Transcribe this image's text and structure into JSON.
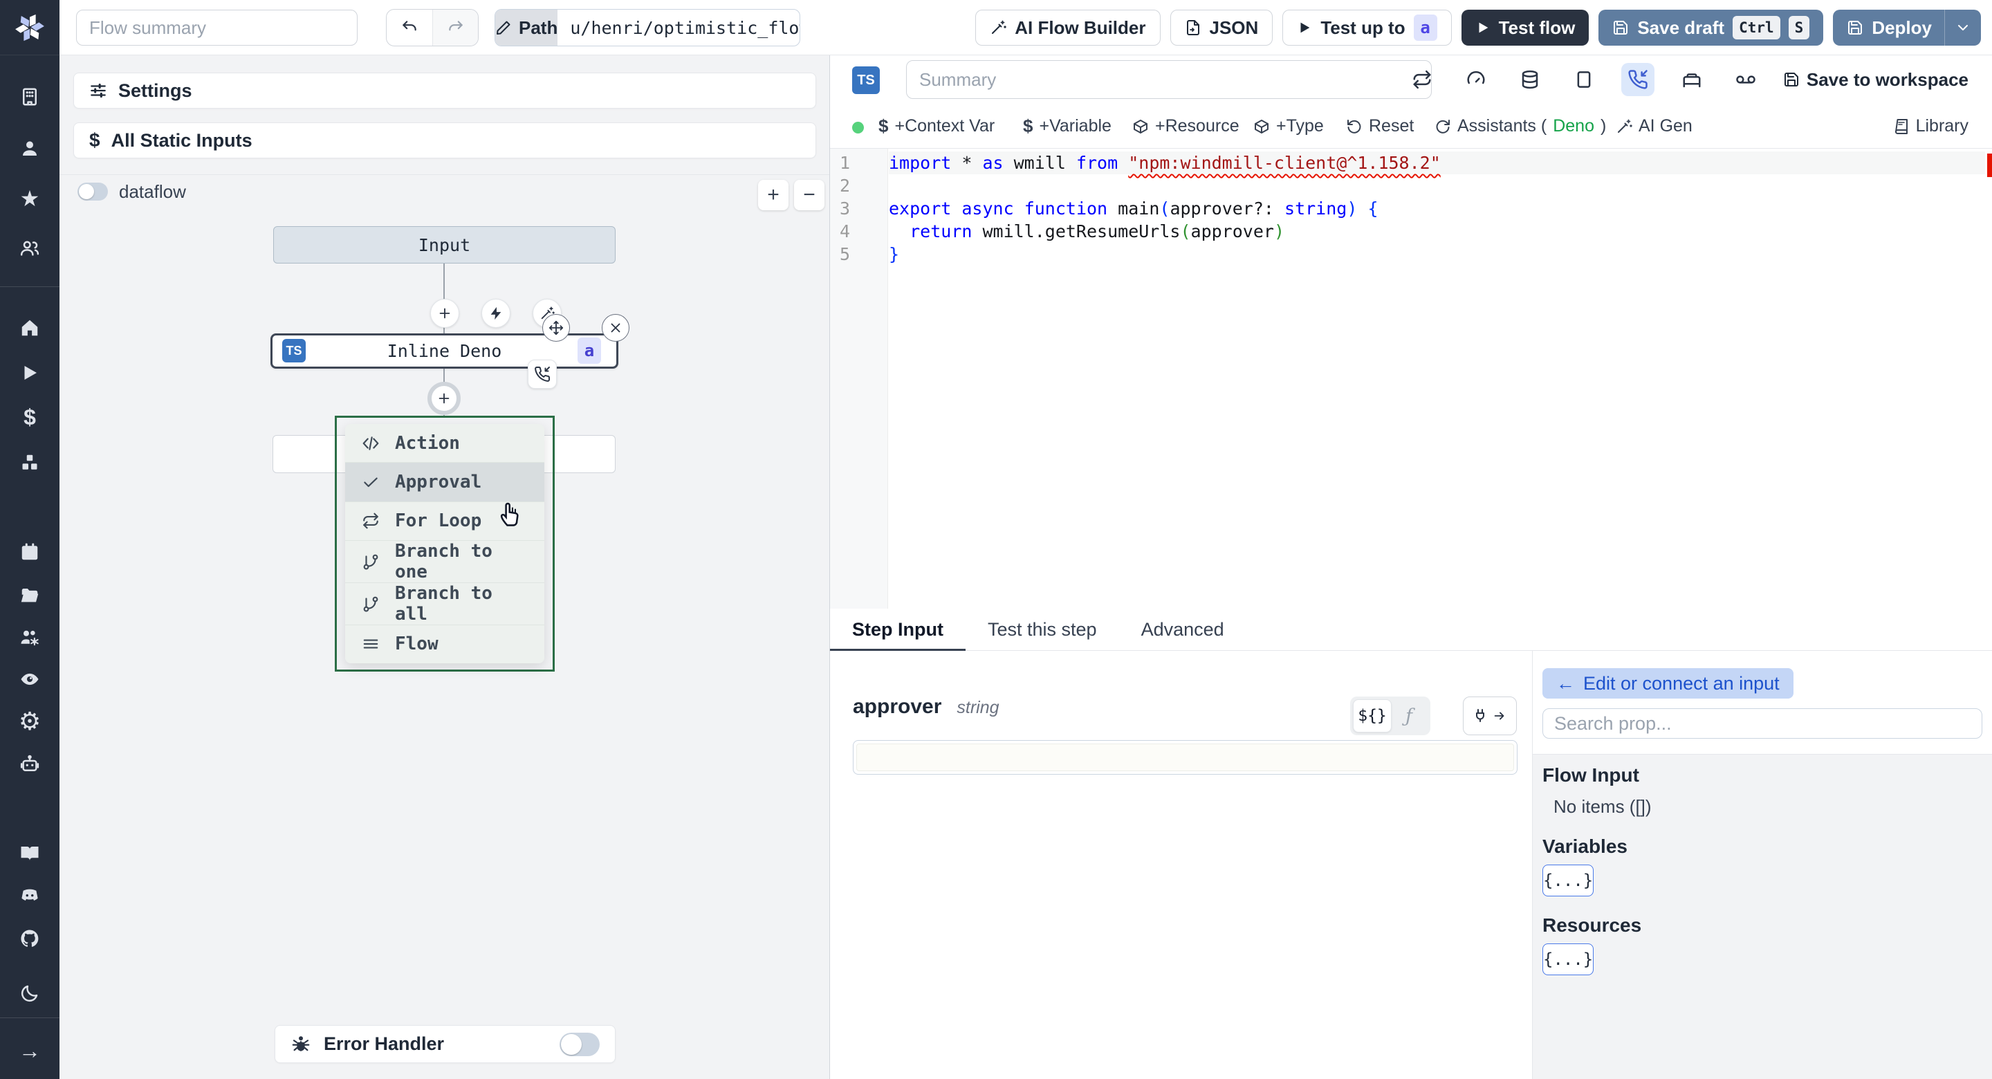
{
  "topbar": {
    "flow_summary_placeholder": "Flow summary",
    "path_label": "Path",
    "path_value": "u/henri/optimistic_flow",
    "ai_flow_builder": "AI Flow Builder",
    "json_label": "JSON",
    "test_up_to": "Test up to",
    "test_up_to_badge": "a",
    "test_flow": "Test flow",
    "save_draft": "Save draft",
    "kbd_ctrl": "Ctrl",
    "kbd_s": "S",
    "deploy": "Deploy"
  },
  "flow_panel": {
    "settings": "Settings",
    "all_static_inputs": "All Static Inputs",
    "dataflow": "dataflow",
    "input_node": "Input",
    "step_node": {
      "ts": "TS",
      "label": "Inline Deno",
      "badge": "a"
    },
    "menu": {
      "items": [
        {
          "label": "Action"
        },
        {
          "label": "Approval"
        },
        {
          "label": "For Loop"
        },
        {
          "label": "Branch to one"
        },
        {
          "label": "Branch to all"
        },
        {
          "label": "Flow"
        }
      ]
    },
    "error_handler": "Error Handler"
  },
  "editor": {
    "ts": "TS",
    "summary_placeholder": "Summary",
    "save_to_workspace": "Save to workspace",
    "toolbar": {
      "context_var": "+Context Var",
      "variable": "+Variable",
      "resource": "+Resource",
      "type": "+Type",
      "reset": "Reset",
      "assistants_prefix": "Assistants (",
      "assistants_lang": "Deno",
      "assistants_suffix": ")",
      "ai_gen": "AI Gen",
      "library": "Library"
    },
    "code": {
      "lines": [
        [
          [
            "kw",
            "import"
          ],
          [
            "pl",
            " * "
          ],
          [
            "kw",
            "as"
          ],
          [
            "pl",
            " wmill "
          ],
          [
            "kw",
            "from"
          ],
          [
            "pl",
            " "
          ],
          [
            "se",
            "\"npm:windmill-client@^1.158.2\""
          ]
        ],
        [],
        [
          [
            "kw",
            "export"
          ],
          [
            "pl",
            " "
          ],
          [
            "kw",
            "async"
          ],
          [
            "pl",
            " "
          ],
          [
            "kw",
            "function"
          ],
          [
            "pl",
            " main"
          ],
          [
            "b1",
            "("
          ],
          [
            "pl",
            "approver?: "
          ],
          [
            "kw",
            "string"
          ],
          [
            "b1",
            ")"
          ],
          [
            "pl",
            " "
          ],
          [
            "b1",
            "{"
          ]
        ],
        [
          [
            "pl",
            "  "
          ],
          [
            "kw",
            "return"
          ],
          [
            "pl",
            " wmill.getResumeUrls"
          ],
          [
            "b2",
            "("
          ],
          [
            "pl",
            "approver"
          ],
          [
            "b2",
            ")"
          ]
        ],
        [
          [
            "b1",
            "}"
          ]
        ]
      ]
    }
  },
  "tabs": [
    {
      "label": "Step Input"
    },
    {
      "label": "Test this step"
    },
    {
      "label": "Advanced"
    }
  ],
  "step_input": {
    "name": "approver",
    "type": "string",
    "expr_toggle": "${}",
    "fn_toggle": "ƒ"
  },
  "connect_panel": {
    "back_arrow": "←",
    "edit_button": "Edit or connect an input",
    "search_placeholder": "Search prop...",
    "flow_input_heading": "Flow Input",
    "no_items": "No items ([])",
    "variables_heading": "Variables",
    "resources_heading": "Resources",
    "object_chip": "{...}"
  },
  "colors": {
    "sidebar_bg": "#252d3b",
    "steel_blue_button": "#5f7da0",
    "dark_button": "#2a3240",
    "ts_badge_blue": "#3774c0",
    "indigo_badge_bg": "#dfe3fc",
    "indigo_badge_text": "#4f46e5",
    "menu_selection_green": "#2c6f47",
    "active_icon_bg": "#dce8fb",
    "status_dot_green": "#56d27c",
    "code_keyword": "#0000ff",
    "code_string": "#a31515",
    "error_marker": "#e51400"
  }
}
